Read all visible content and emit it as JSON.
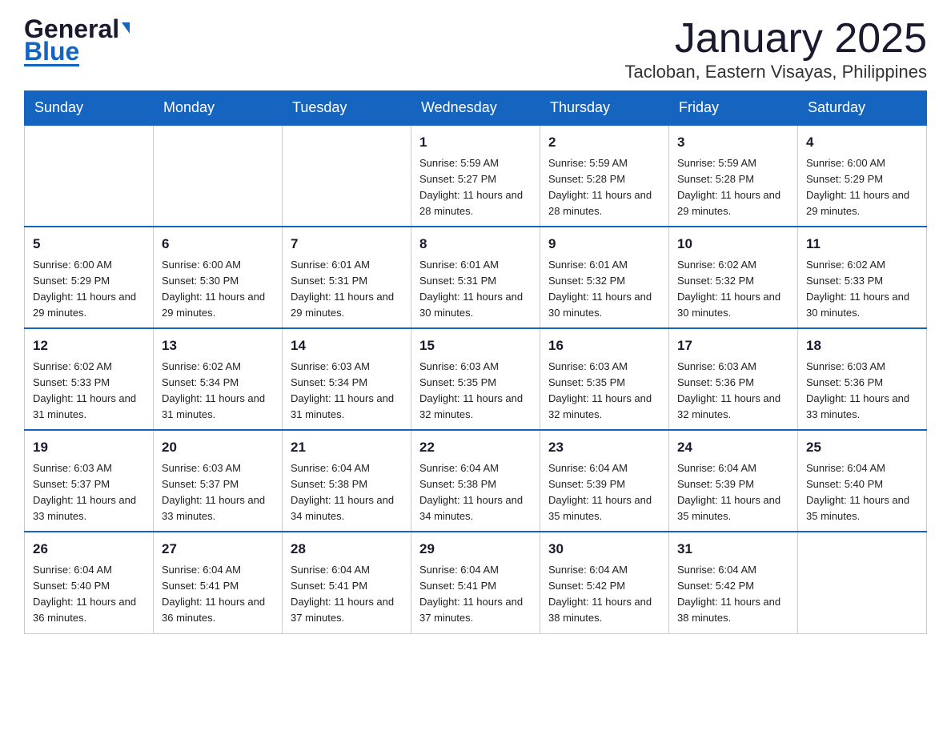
{
  "header": {
    "month_title": "January 2025",
    "location": "Tacloban, Eastern Visayas, Philippines",
    "logo_general": "General",
    "logo_blue": "Blue"
  },
  "days": [
    "Sunday",
    "Monday",
    "Tuesday",
    "Wednesday",
    "Thursday",
    "Friday",
    "Saturday"
  ],
  "weeks": [
    [
      {
        "date": "",
        "info": ""
      },
      {
        "date": "",
        "info": ""
      },
      {
        "date": "",
        "info": ""
      },
      {
        "date": "1",
        "info": "Sunrise: 5:59 AM\nSunset: 5:27 PM\nDaylight: 11 hours\nand 28 minutes."
      },
      {
        "date": "2",
        "info": "Sunrise: 5:59 AM\nSunset: 5:28 PM\nDaylight: 11 hours\nand 28 minutes."
      },
      {
        "date": "3",
        "info": "Sunrise: 5:59 AM\nSunset: 5:28 PM\nDaylight: 11 hours\nand 29 minutes."
      },
      {
        "date": "4",
        "info": "Sunrise: 6:00 AM\nSunset: 5:29 PM\nDaylight: 11 hours\nand 29 minutes."
      }
    ],
    [
      {
        "date": "5",
        "info": "Sunrise: 6:00 AM\nSunset: 5:29 PM\nDaylight: 11 hours\nand 29 minutes."
      },
      {
        "date": "6",
        "info": "Sunrise: 6:00 AM\nSunset: 5:30 PM\nDaylight: 11 hours\nand 29 minutes."
      },
      {
        "date": "7",
        "info": "Sunrise: 6:01 AM\nSunset: 5:31 PM\nDaylight: 11 hours\nand 29 minutes."
      },
      {
        "date": "8",
        "info": "Sunrise: 6:01 AM\nSunset: 5:31 PM\nDaylight: 11 hours\nand 30 minutes."
      },
      {
        "date": "9",
        "info": "Sunrise: 6:01 AM\nSunset: 5:32 PM\nDaylight: 11 hours\nand 30 minutes."
      },
      {
        "date": "10",
        "info": "Sunrise: 6:02 AM\nSunset: 5:32 PM\nDaylight: 11 hours\nand 30 minutes."
      },
      {
        "date": "11",
        "info": "Sunrise: 6:02 AM\nSunset: 5:33 PM\nDaylight: 11 hours\nand 30 minutes."
      }
    ],
    [
      {
        "date": "12",
        "info": "Sunrise: 6:02 AM\nSunset: 5:33 PM\nDaylight: 11 hours\nand 31 minutes."
      },
      {
        "date": "13",
        "info": "Sunrise: 6:02 AM\nSunset: 5:34 PM\nDaylight: 11 hours\nand 31 minutes."
      },
      {
        "date": "14",
        "info": "Sunrise: 6:03 AM\nSunset: 5:34 PM\nDaylight: 11 hours\nand 31 minutes."
      },
      {
        "date": "15",
        "info": "Sunrise: 6:03 AM\nSunset: 5:35 PM\nDaylight: 11 hours\nand 32 minutes."
      },
      {
        "date": "16",
        "info": "Sunrise: 6:03 AM\nSunset: 5:35 PM\nDaylight: 11 hours\nand 32 minutes."
      },
      {
        "date": "17",
        "info": "Sunrise: 6:03 AM\nSunset: 5:36 PM\nDaylight: 11 hours\nand 32 minutes."
      },
      {
        "date": "18",
        "info": "Sunrise: 6:03 AM\nSunset: 5:36 PM\nDaylight: 11 hours\nand 33 minutes."
      }
    ],
    [
      {
        "date": "19",
        "info": "Sunrise: 6:03 AM\nSunset: 5:37 PM\nDaylight: 11 hours\nand 33 minutes."
      },
      {
        "date": "20",
        "info": "Sunrise: 6:03 AM\nSunset: 5:37 PM\nDaylight: 11 hours\nand 33 minutes."
      },
      {
        "date": "21",
        "info": "Sunrise: 6:04 AM\nSunset: 5:38 PM\nDaylight: 11 hours\nand 34 minutes."
      },
      {
        "date": "22",
        "info": "Sunrise: 6:04 AM\nSunset: 5:38 PM\nDaylight: 11 hours\nand 34 minutes."
      },
      {
        "date": "23",
        "info": "Sunrise: 6:04 AM\nSunset: 5:39 PM\nDaylight: 11 hours\nand 35 minutes."
      },
      {
        "date": "24",
        "info": "Sunrise: 6:04 AM\nSunset: 5:39 PM\nDaylight: 11 hours\nand 35 minutes."
      },
      {
        "date": "25",
        "info": "Sunrise: 6:04 AM\nSunset: 5:40 PM\nDaylight: 11 hours\nand 35 minutes."
      }
    ],
    [
      {
        "date": "26",
        "info": "Sunrise: 6:04 AM\nSunset: 5:40 PM\nDaylight: 11 hours\nand 36 minutes."
      },
      {
        "date": "27",
        "info": "Sunrise: 6:04 AM\nSunset: 5:41 PM\nDaylight: 11 hours\nand 36 minutes."
      },
      {
        "date": "28",
        "info": "Sunrise: 6:04 AM\nSunset: 5:41 PM\nDaylight: 11 hours\nand 37 minutes."
      },
      {
        "date": "29",
        "info": "Sunrise: 6:04 AM\nSunset: 5:41 PM\nDaylight: 11 hours\nand 37 minutes."
      },
      {
        "date": "30",
        "info": "Sunrise: 6:04 AM\nSunset: 5:42 PM\nDaylight: 11 hours\nand 38 minutes."
      },
      {
        "date": "31",
        "info": "Sunrise: 6:04 AM\nSunset: 5:42 PM\nDaylight: 11 hours\nand 38 minutes."
      },
      {
        "date": "",
        "info": ""
      }
    ]
  ]
}
